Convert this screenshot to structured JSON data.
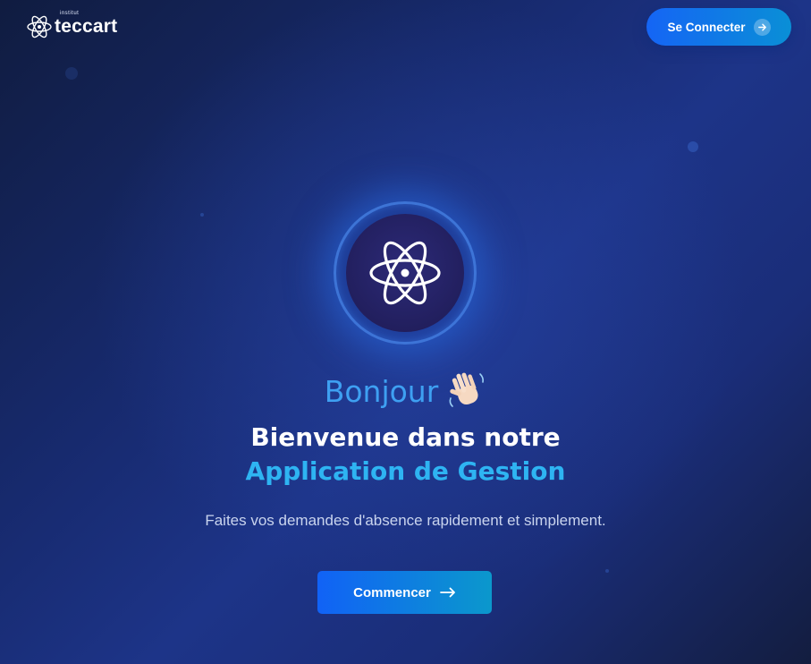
{
  "header": {
    "logo_small": "institut",
    "logo_text": "teccart",
    "login_label": "Se Connecter",
    "login_icon": "arrow-right-icon"
  },
  "hero": {
    "icon": "atom-icon",
    "greeting": "Bonjour",
    "greeting_icon": "waving-hand-icon",
    "headline_line1": "Bienvenue dans notre",
    "headline_line2": "Application de Gestion",
    "subtitle": "Faites vos demandes d'absence rapidement et simplement.",
    "cta_label": "Commencer",
    "cta_icon": "arrow-right-icon"
  },
  "colors": {
    "accent_blue": "#3ea0f2",
    "accent_cyan": "#2eb4f2",
    "button_start": "#1162f6",
    "button_end": "#0b98cc",
    "background_dark": "#131d3f"
  }
}
